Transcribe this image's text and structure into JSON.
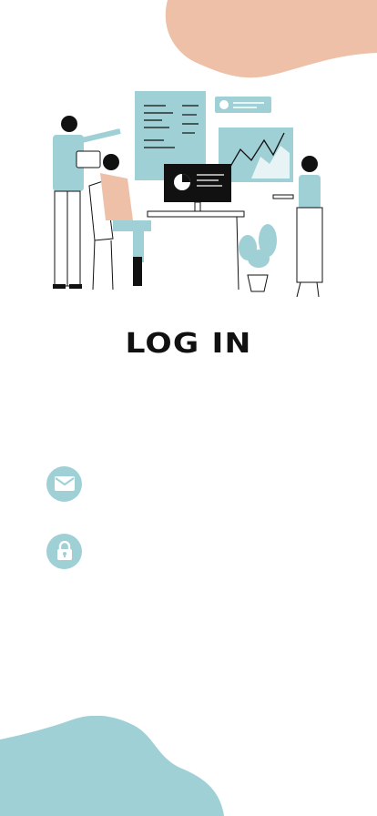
{
  "title": "LOG IN",
  "email_field": {
    "icon": "envelope-icon",
    "value": "",
    "placeholder": ""
  },
  "password_field": {
    "icon": "lock-icon",
    "value": "",
    "placeholder": ""
  },
  "colors": {
    "accent": "#9fd0d5",
    "peach": "#eec0a8",
    "text": "#111111"
  }
}
